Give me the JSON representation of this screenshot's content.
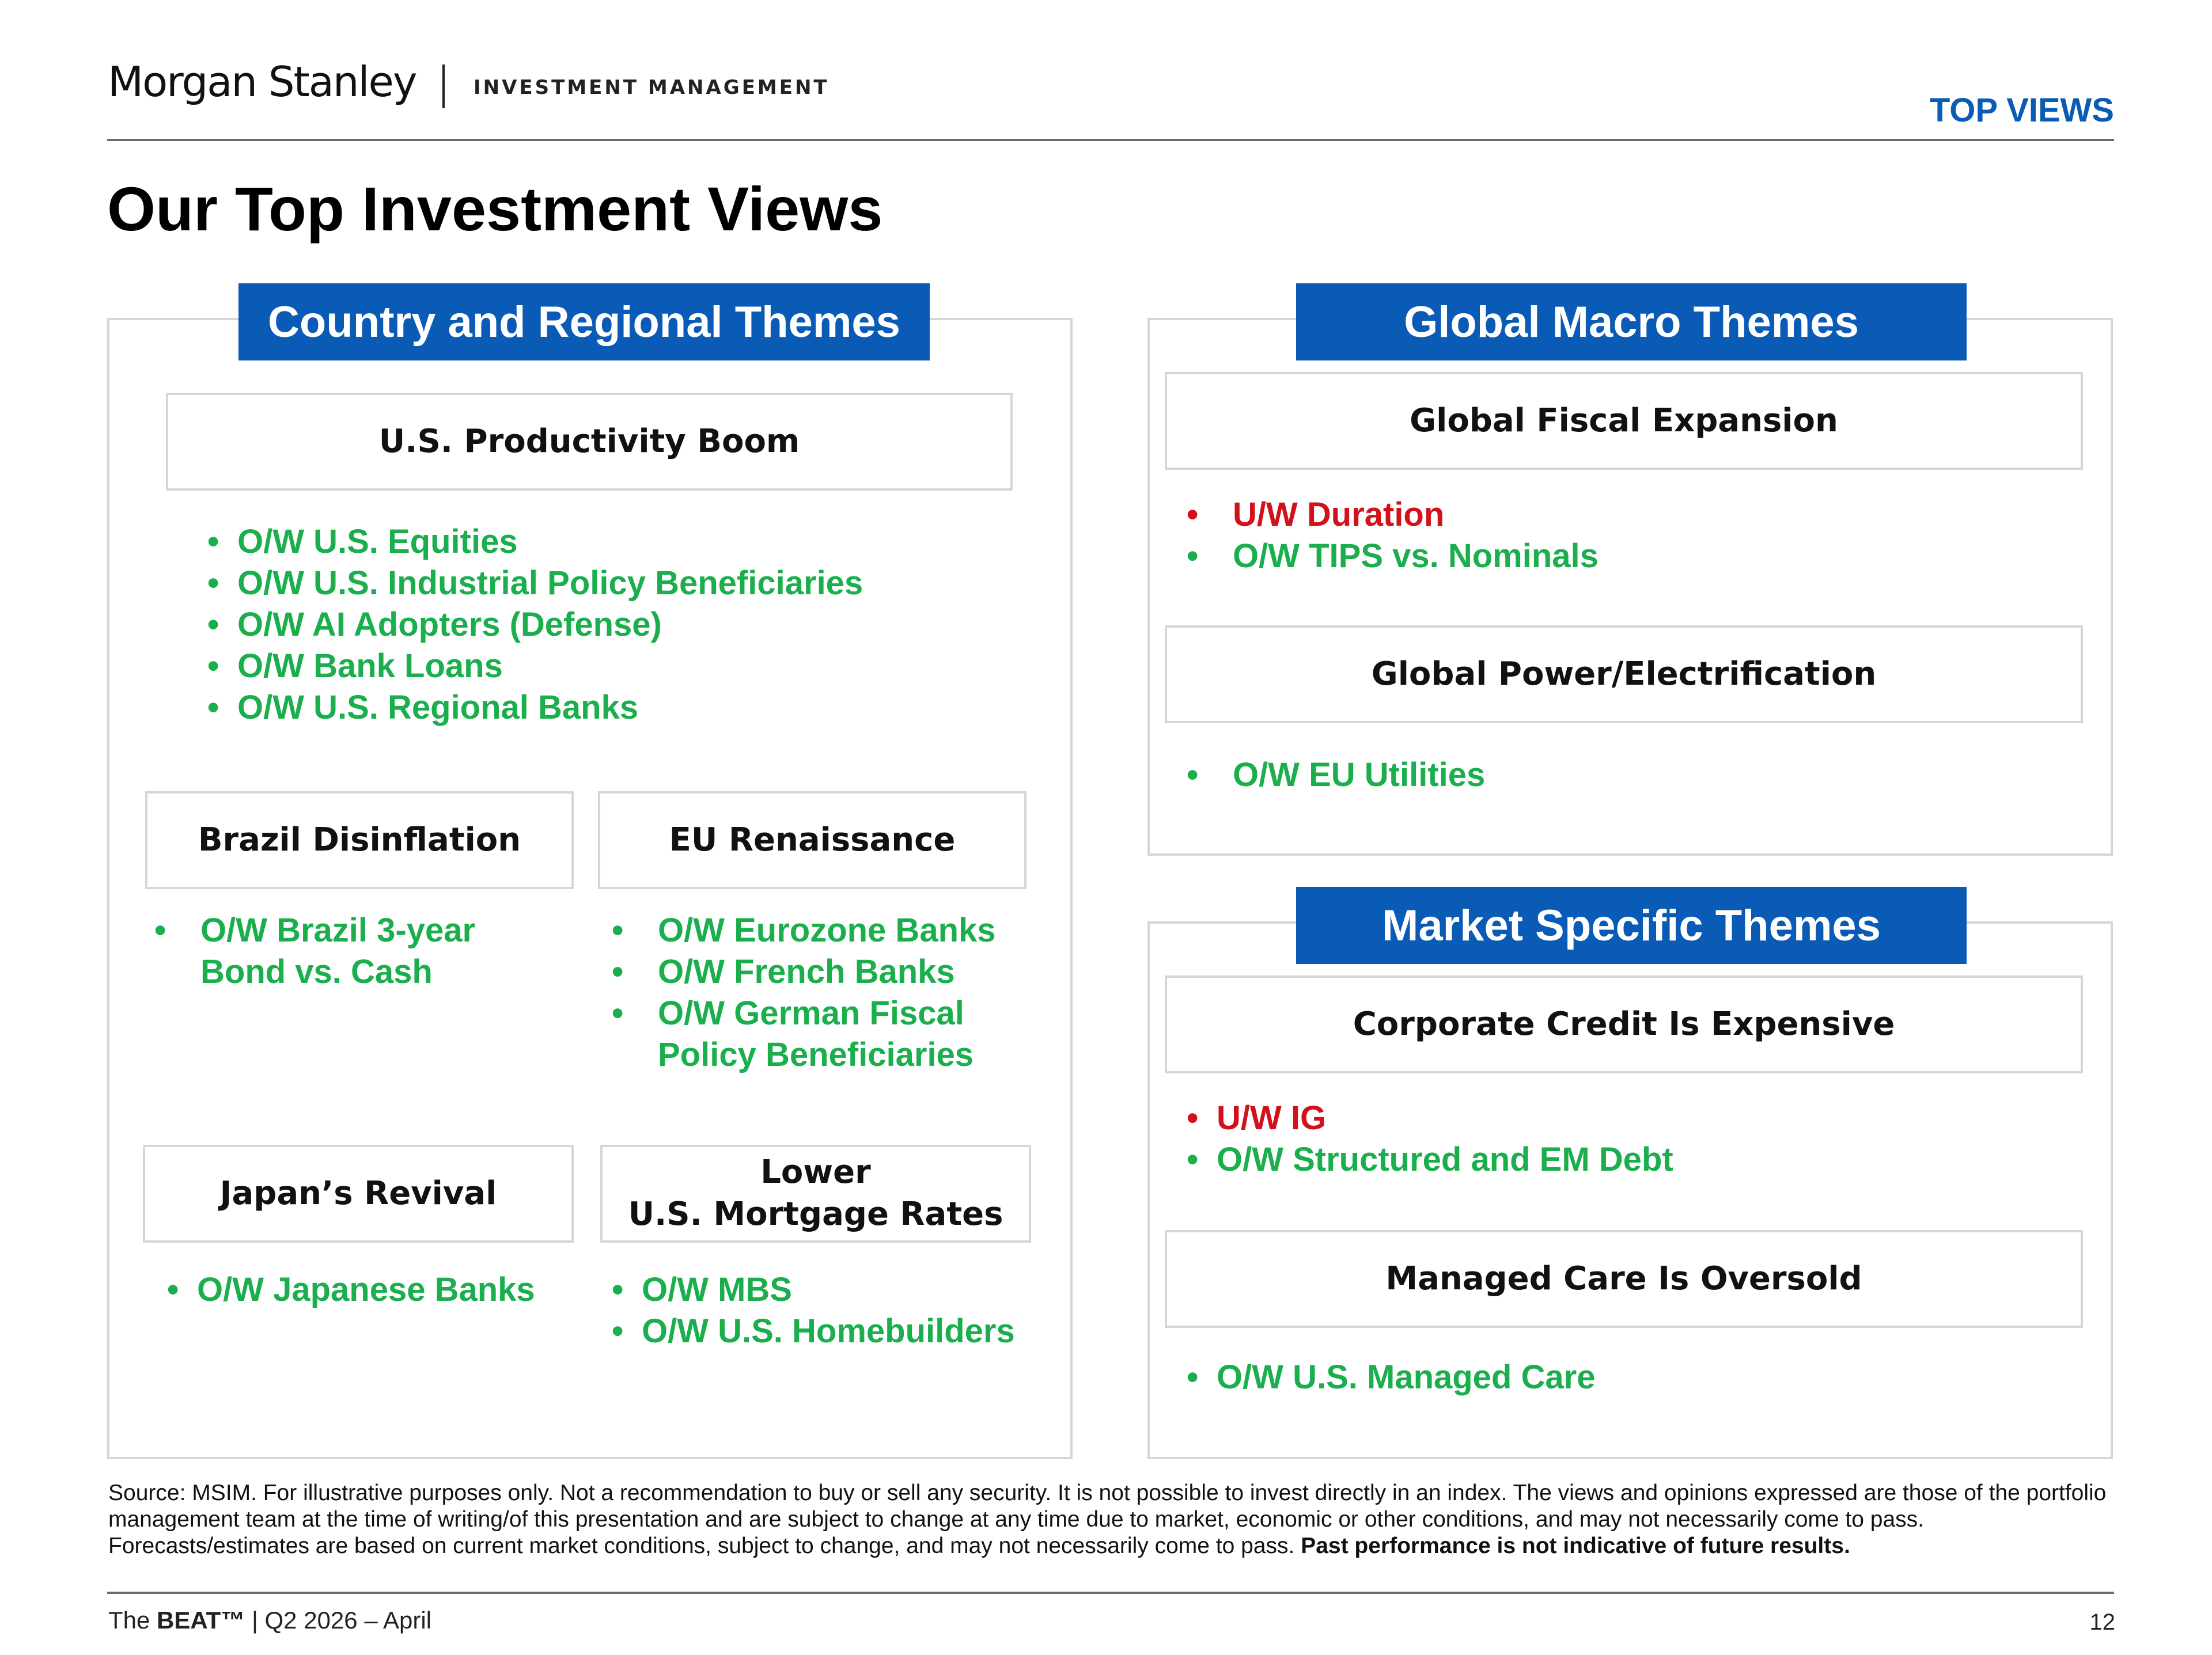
{
  "header": {
    "brand": "Morgan Stanley",
    "brand_sub": "INVESTMENT MANAGEMENT",
    "section_tag": "TOP VIEWS"
  },
  "title": "Our Top Investment Views",
  "country_regional": {
    "banner": "Country and Regional Themes",
    "us_productivity": {
      "title": "U.S. Productivity Boom",
      "bullets": [
        "O/W U.S. Equities",
        "O/W U.S. Industrial Policy Beneficiaries",
        "O/W AI Adopters (Defense)",
        "O/W Bank Loans",
        "O/W U.S. Regional Banks"
      ]
    },
    "brazil": {
      "title": "Brazil Disinflation",
      "bullets": [
        {
          "line1": "O/W Brazil 3-year",
          "line2": "Bond vs. Cash"
        }
      ]
    },
    "eu": {
      "title": "EU Renaissance",
      "bullets": [
        "O/W Eurozone Banks",
        "O/W French Banks",
        {
          "line1": "O/W German Fiscal",
          "line2": "Policy Beneficiaries"
        }
      ]
    },
    "japan": {
      "title": "Japan’s Revival",
      "bullets": [
        "O/W Japanese Banks"
      ]
    },
    "mortgage": {
      "title_line1": "Lower",
      "title_line2": "U.S. Mortgage Rates",
      "bullets": [
        "O/W MBS",
        "O/W U.S. Homebuilders"
      ]
    }
  },
  "global_macro": {
    "banner": "Global Macro Themes",
    "fiscal": {
      "title": "Global Fiscal Expansion",
      "bullets": [
        "U/W Duration",
        "O/W TIPS vs. Nominals"
      ]
    },
    "power": {
      "title": "Global Power/Electrification",
      "bullets": [
        "O/W EU Utilities"
      ]
    }
  },
  "market_specific": {
    "banner": "Market Specific Themes",
    "credit": {
      "title": "Corporate Credit Is Expensive",
      "bullets": [
        "U/W IG",
        "O/W Structured and EM Debt"
      ]
    },
    "managed_care": {
      "title": "Managed Care Is Oversold",
      "bullets": [
        "O/W U.S. Managed Care"
      ]
    }
  },
  "colors": {
    "brand_blue": "#0a5bb5",
    "overweight_green": "#1aaf4c",
    "underweight_red": "#d2111a"
  },
  "footer": {
    "disclaimer": "Source: MSIM. For illustrative purposes only. Not a recommendation to buy or sell any security. It is not possible to invest directly in an index. The views and opinions expressed are those of the portfolio management team at the time of writing/of this presentation and are subject to change at any time due to market, economic or other conditions, and may not necessarily come to pass. Forecasts/estimates are based on current market conditions, subject to change, and may not necessarily come to pass.",
    "disclaimer_bold": "Past performance is not indicative of future results.",
    "publication_prefix": "The",
    "publication_name": "BEAT™",
    "publication_suffix": "| Q2 2026 – April",
    "page_number": "12"
  }
}
